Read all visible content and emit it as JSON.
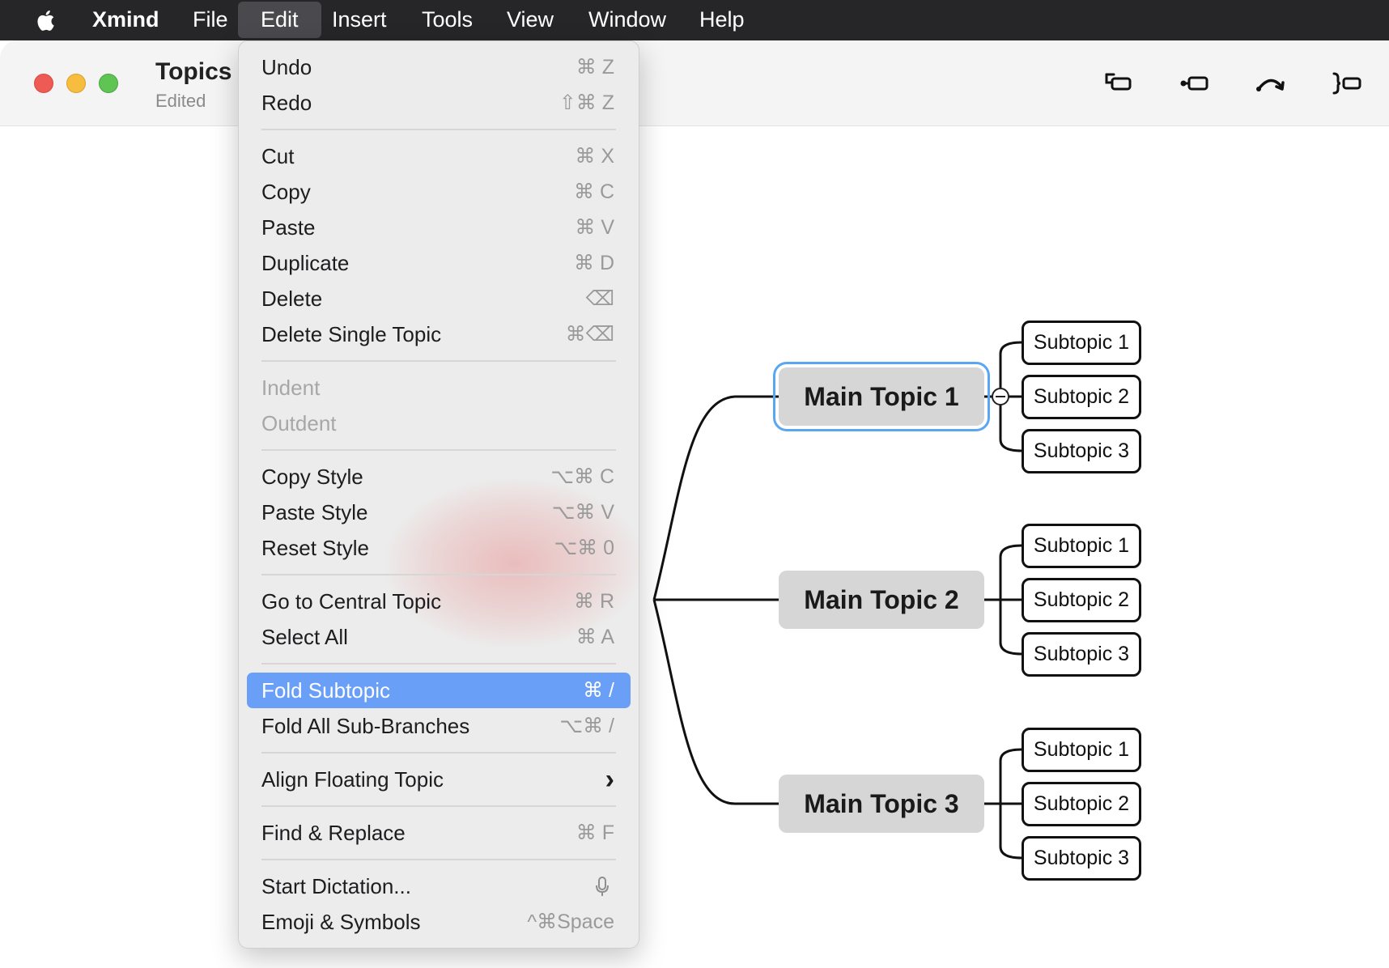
{
  "menubar": {
    "apple_icon": "apple-logo-icon",
    "items": [
      "Xmind",
      "File",
      "Edit",
      "Insert",
      "Tools",
      "View",
      "Window",
      "Help"
    ],
    "active": "Edit"
  },
  "window": {
    "title": "Topics",
    "status": "Edited",
    "toolbar_icons": [
      "insert-subtopic-icon",
      "insert-topic-before-icon",
      "relationship-icon",
      "summary-icon"
    ]
  },
  "edit_menu": {
    "items": [
      {
        "label": "Undo",
        "shortcut": "⌘ Z"
      },
      {
        "label": "Redo",
        "shortcut": "⇧⌘ Z"
      },
      {
        "label": "Cut",
        "shortcut": "⌘ X"
      },
      {
        "label": "Copy",
        "shortcut": "⌘ C"
      },
      {
        "label": "Paste",
        "shortcut": "⌘ V"
      },
      {
        "label": "Duplicate",
        "shortcut": "⌘ D"
      },
      {
        "label": "Delete",
        "shortcut": "⌫"
      },
      {
        "label": "Delete Single Topic",
        "shortcut": "⌘⌫"
      },
      {
        "label": "Indent",
        "shortcut": "",
        "disabled": true
      },
      {
        "label": "Outdent",
        "shortcut": "",
        "disabled": true
      },
      {
        "label": "Copy Style",
        "shortcut": "⌥⌘ C"
      },
      {
        "label": "Paste Style",
        "shortcut": "⌥⌘ V"
      },
      {
        "label": "Reset Style",
        "shortcut": "⌥⌘ 0"
      },
      {
        "label": "Go to Central Topic",
        "shortcut": "⌘ R"
      },
      {
        "label": "Select All",
        "shortcut": "⌘ A"
      },
      {
        "label": "Fold Subtopic",
        "shortcut": "⌘  /",
        "highlighted": true
      },
      {
        "label": "Fold All Sub-Branches",
        "shortcut": "⌥⌘  /"
      },
      {
        "label": "Align Floating Topic",
        "shortcut": "›",
        "submenu": true
      },
      {
        "label": "Find & Replace",
        "shortcut": "⌘ F"
      },
      {
        "label": "Start Dictation...",
        "shortcut": "",
        "icon": "microphone-icon"
      },
      {
        "label": "Emoji & Symbols",
        "shortcut": "^⌘Space"
      }
    ],
    "highlighted_item": "Fold Subtopic",
    "highlight_color": "#6a9ff7"
  },
  "mindmap": {
    "main_topics": [
      {
        "label": "Main Topic 1",
        "selected": true,
        "subtopics": [
          "Subtopic 1",
          "Subtopic 2",
          "Subtopic 3"
        ]
      },
      {
        "label": "Main Topic 2",
        "subtopics": [
          "Subtopic 1",
          "Subtopic 2",
          "Subtopic 3"
        ]
      },
      {
        "label": "Main Topic 3",
        "subtopics": [
          "Subtopic 1",
          "Subtopic 2",
          "Subtopic 3"
        ]
      }
    ],
    "selection_color": "#5aa6f2",
    "topic_fill": "#d6d6d6"
  }
}
